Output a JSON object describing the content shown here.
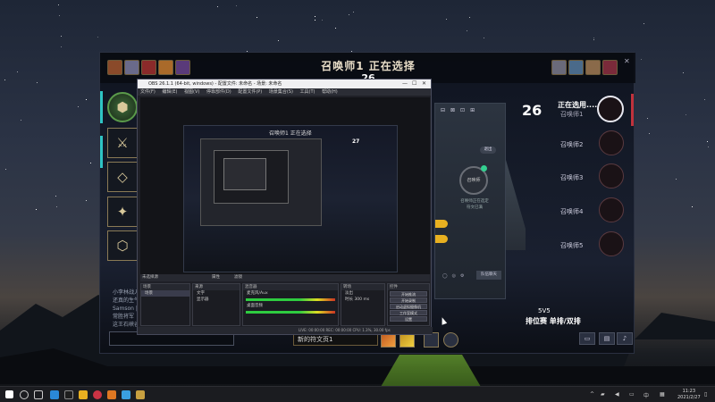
{
  "game": {
    "title": "召唤师1 正在选择",
    "timer": "26",
    "right_panel": {
      "count": "26",
      "status": "正在选用......",
      "players": [
        "召唤师1",
        "召唤师2",
        "召唤师3",
        "召唤师4",
        "召唤师5"
      ]
    },
    "chat_lines": [
      "小李林战入",
      "还真的生气",
      "Samson |",
      "常胜将军",
      "这王石峡谷"
    ],
    "mode_count": "5V5",
    "mode_label": "排位赛 单排/双排",
    "skin_select": "新的符文页1",
    "accent_color": "#c0323c",
    "lane_marker_color": "#2ec4c4"
  },
  "obs": {
    "title": "OBS 26.1.1 (64-bit, windows) - 配置文件: 未命名 - 场景: 未命名",
    "menu": [
      "文件(F)",
      "编辑(E)",
      "视图(V)",
      "停靠部件(D)",
      "配置文件(P)",
      "场景集合(S)",
      "工具(T)",
      "帮助(H)"
    ],
    "toolbar_left": "未选择源",
    "toolbar_mid1": "属性",
    "toolbar_mid2": "滤镜",
    "panels": {
      "scenes": {
        "header": "场景",
        "items": [
          "场景"
        ]
      },
      "sources": {
        "header": "来源",
        "items": [
          "文字",
          "显示器"
        ]
      },
      "mixer": {
        "header": "混音器",
        "ch1": "麦克风/Aux",
        "ch2": "桌面音频"
      },
      "transitions": {
        "header": "转场",
        "fade": "淡出",
        "duration_label": "时长",
        "duration": "300 ms"
      },
      "controls": {
        "header": "控件",
        "buttons": [
          "开始推流",
          "开始录制",
          "启动虚拟摄像机",
          "工作室模式",
          "设置",
          "退出"
        ]
      }
    },
    "status": "LIVE: 00:00:00   REC: 00:00:00   CPU: 1.3%, 30.00 fps",
    "inner_title": "召唤师1 正在选择",
    "inner_count": "27"
  },
  "float_panel": {
    "exit_pill": "退出",
    "ring_text": "召唤师",
    "caption1": "召唤师正在选定",
    "caption2": "符文已满",
    "bottom_btn": "队伍聊天"
  },
  "taskbar": {
    "time": "11:23",
    "date": "2021/2/27"
  }
}
